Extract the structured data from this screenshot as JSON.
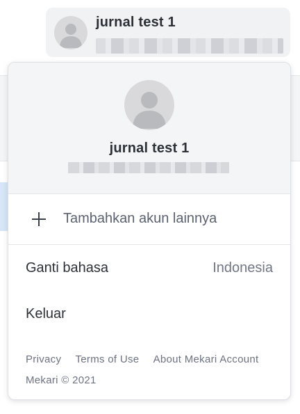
{
  "account_chip": {
    "name": "jurnal test 1",
    "avatar_icon": "user-avatar-icon"
  },
  "menu": {
    "header": {
      "name": "jurnal test 1",
      "avatar_icon": "user-avatar-icon"
    },
    "add_account": {
      "icon": "plus-icon",
      "label": "Tambahkan akun lainnya"
    },
    "language": {
      "label": "Ganti bahasa",
      "value": "Indonesia"
    },
    "logout": {
      "label": "Keluar"
    },
    "footer": {
      "links": [
        "Privacy",
        "Terms of Use",
        "About Mekari Account"
      ],
      "copyright": "Mekari © 2021"
    }
  },
  "colors": {
    "avatar_bg": "#d9d9dc",
    "avatar_fg": "#b9babe",
    "header_bg": "#f4f5f7",
    "text_primary": "#2b2f36",
    "text_secondary": "#707686"
  }
}
